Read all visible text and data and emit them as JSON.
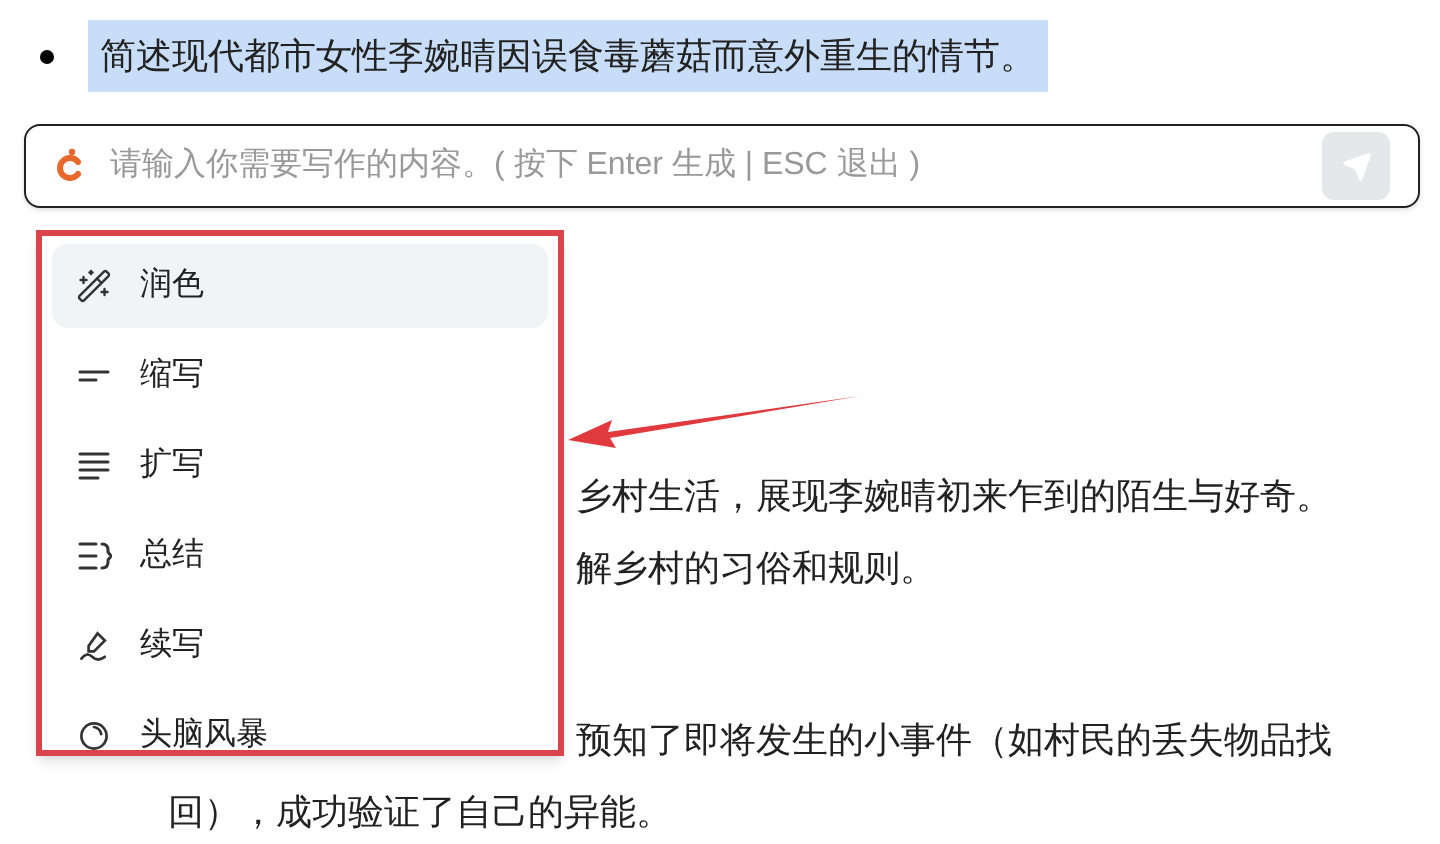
{
  "document": {
    "lines": [
      {
        "kind": "bullet",
        "text": "简述现代都市女性李婉晴因误食毒蘑菇而意外重生的情节。",
        "selected": true
      },
      {
        "kind": "partial",
        "text": "乡村生活，展现李婉晴初来乍到的陌生与好奇。",
        "selected": false
      },
      {
        "kind": "partial",
        "text": "解乡村的习俗和规则。",
        "selected": false
      },
      {
        "kind": "partial",
        "text": "预知了即将发生的小事件（如村民的丢失物品找",
        "selected": false
      },
      {
        "kind": "deep",
        "text": "回），成功验证了自己的异能。",
        "selected": false
      }
    ]
  },
  "prompt_bar": {
    "placeholder": "请输入你需要写作的内容。( 按下 Enter 生成 | ESC 退出 )",
    "send_disabled": true
  },
  "menu": {
    "items": [
      {
        "kind": "wand",
        "label": "润色",
        "selected": true
      },
      {
        "kind": "shorten",
        "label": "缩写",
        "selected": false
      },
      {
        "kind": "expand",
        "label": "扩写",
        "selected": false
      },
      {
        "kind": "summary",
        "label": "总结",
        "selected": false
      },
      {
        "kind": "continue",
        "label": "续写",
        "selected": false
      },
      {
        "kind": "brainstorm",
        "label": "头脑风暴",
        "selected": false
      }
    ]
  }
}
